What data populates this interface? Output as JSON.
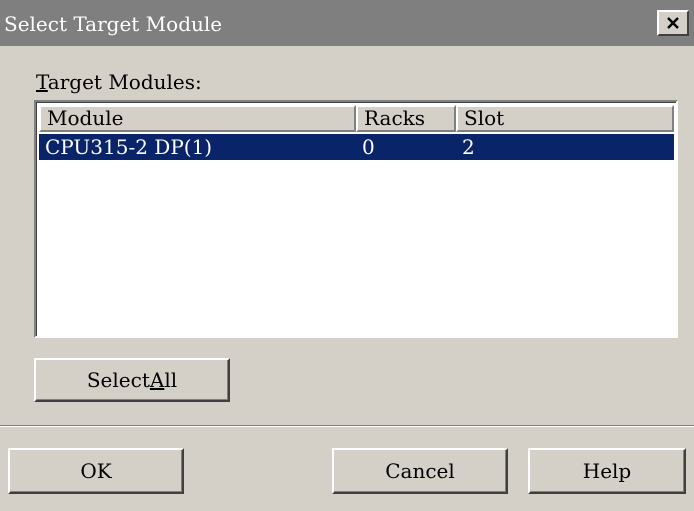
{
  "window": {
    "title": "Select Target Module",
    "close_icon": "close-icon"
  },
  "targets": {
    "label_first": "T",
    "label_rest": "arget Modules:",
    "columns": [
      "Module",
      "Racks",
      "Slot"
    ],
    "rows": [
      {
        "module": "CPU315-2 DP(1)",
        "racks": "0",
        "slot": "2",
        "selected": true
      }
    ],
    "selection_color": "#0a246a"
  },
  "buttons": {
    "select_all_prefix": "Select ",
    "select_all_accel": "A",
    "select_all_suffix": "ll",
    "ok": "OK",
    "cancel": "Cancel",
    "help": "Help"
  }
}
